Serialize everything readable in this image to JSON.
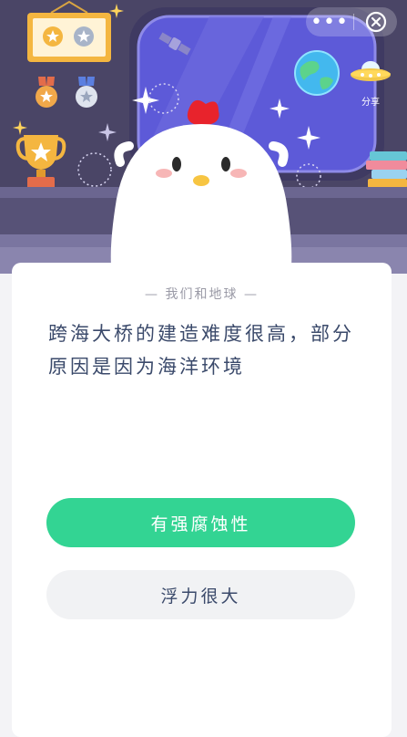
{
  "toolbar": {
    "more_label": "•••",
    "share_label": "分享"
  },
  "card": {
    "category": "— 我们和地球 —",
    "question": "跨海大桥的建造难度很高，部分原因是因为海洋环境",
    "options": [
      {
        "label": "有强腐蚀性"
      },
      {
        "label": "浮力很大"
      }
    ]
  },
  "colors": {
    "accent": "#33d493",
    "scene_bg": "#4a4566",
    "window": "#5a58d6",
    "text": "#3b4a6b"
  }
}
